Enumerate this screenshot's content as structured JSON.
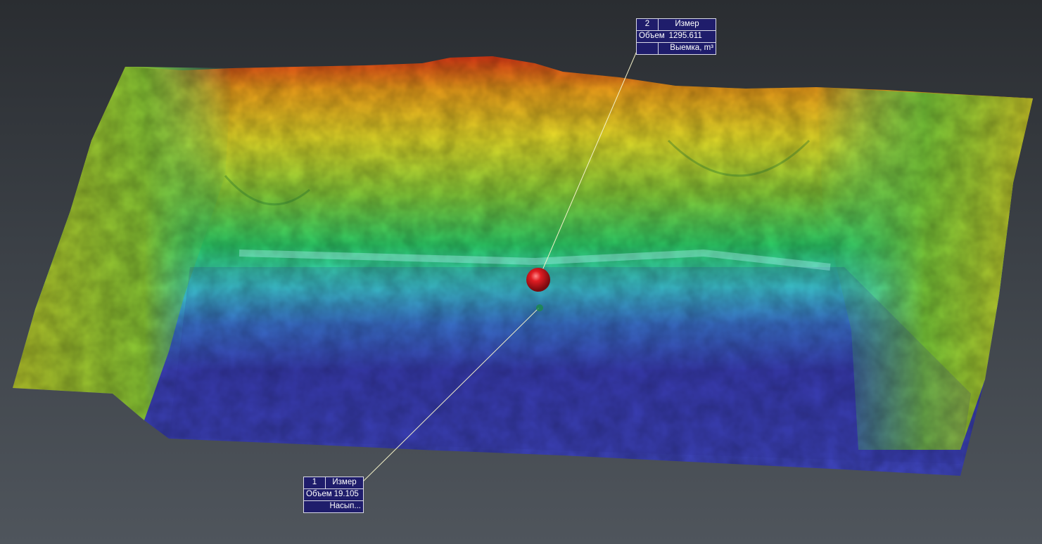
{
  "scene": {
    "colors": {
      "low": "#3b3fb8",
      "mid": "#35d7d0",
      "midhigh": "#4ccb3a",
      "high": "#e7e12a",
      "peak": "#e23a16",
      "marker": "#d4141b",
      "leader": "#f3f1c8",
      "label_bg": "#1f1d6b"
    }
  },
  "measurements": [
    {
      "id": "2",
      "title": "Измер",
      "key": "Объем",
      "value": "1295.611",
      "type": "Выемка, m³"
    },
    {
      "id": "1",
      "title": "Измер",
      "key": "Объем",
      "value": "19.105",
      "type": "Насып..."
    }
  ],
  "icons": {
    "marker_red": "sphere-marker",
    "marker_green": "point-marker"
  }
}
